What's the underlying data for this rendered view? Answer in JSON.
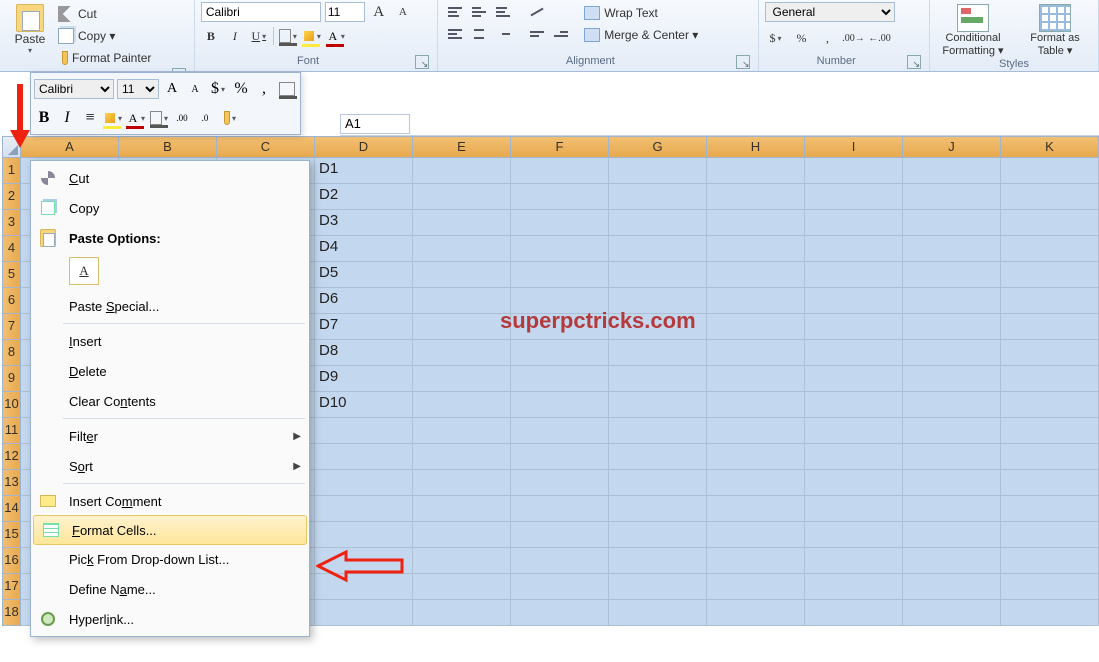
{
  "ribbon": {
    "clipboard": {
      "paste": "Paste",
      "cut": "Cut",
      "copy": "Copy ▾",
      "format_painter": "Format Painter",
      "group_label": ""
    },
    "font": {
      "name": "Calibri",
      "size": "11",
      "group_label": "Font"
    },
    "alignment": {
      "wrap": "Wrap Text",
      "merge": "Merge & Center ▾",
      "group_label": "Alignment"
    },
    "number": {
      "format": "General",
      "group_label": "Number"
    },
    "styles": {
      "conditional": "Conditional Formatting ▾",
      "table": "Format as Table ▾",
      "group_label": "Styles"
    }
  },
  "minitb": {
    "font": "Calibri",
    "size": "11"
  },
  "formula_bar": {
    "name_box": "A1"
  },
  "columns": [
    "A",
    "B",
    "C",
    "D",
    "E",
    "F",
    "G",
    "H",
    "I",
    "J",
    "K"
  ],
  "rows": [
    1,
    2,
    3,
    4,
    5,
    6,
    7,
    8,
    9,
    10,
    11,
    12,
    13,
    14,
    15,
    16,
    17,
    18
  ],
  "dcol": [
    "D1",
    "D2",
    "D3",
    "D4",
    "D5",
    "D6",
    "D7",
    "D8",
    "D9",
    "D10"
  ],
  "watermark": "superpctricks.com",
  "context_menu": {
    "cut": "Cut",
    "copy": "Copy",
    "paste_options": "Paste Options:",
    "paste_special": "Paste Special...",
    "insert": "Insert",
    "delete": "Delete",
    "clear": "Clear Contents",
    "filter": "Filter",
    "sort": "Sort",
    "insert_comment": "Insert Comment",
    "format_cells": "Format Cells...",
    "pick": "Pick From Drop-down List...",
    "define": "Define Name...",
    "hyperlink": "Hyperlink..."
  }
}
